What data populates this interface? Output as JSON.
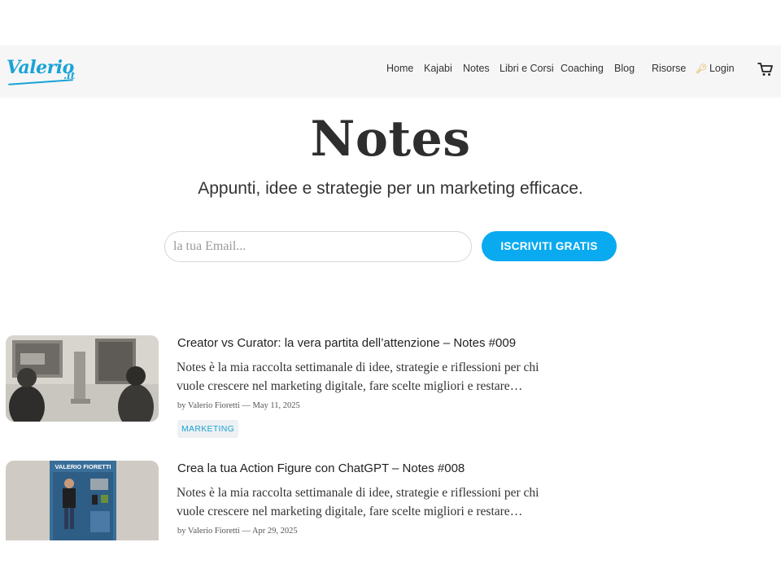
{
  "brand": {
    "logo_text": "Valerio",
    "logo_tld": ".it",
    "accent": "#1aa3d6"
  },
  "nav": {
    "items": [
      "Home",
      "Kajabi",
      "Notes",
      "Libri e Corsi",
      "Coaching",
      "Blog",
      "Risorse"
    ],
    "login": "Login",
    "login_icon": "key-icon",
    "cart_icon": "cart-icon"
  },
  "hero": {
    "title": "Notes",
    "subtitle": "Appunti, idee e strategie per un marketing efficace."
  },
  "subscribe": {
    "placeholder": "la tua Email...",
    "value": "",
    "button": "ISCRIVITI GRATIS",
    "button_color": "#0aaaf0"
  },
  "posts": [
    {
      "title": "Creator vs Curator: la vera partita dell’attenzione – Notes #009",
      "excerpt_line1": "Notes è la mia raccolta settimanale di idee, strategie e riflessioni per chi",
      "excerpt_line2": "vuole crescere nel marketing digitale, fare scelte migliori e restare…",
      "meta": "by Valerio Fioretti — May 11, 2025",
      "tag": "MARKETING"
    },
    {
      "title": "Crea la tua Action Figure con ChatGPT – Notes #008",
      "excerpt_line1": "Notes è la mia raccolta settimanale di idee, strategie e riflessioni per chi",
      "excerpt_line2": "vuole crescere nel marketing digitale, fare scelte migliori e restare…",
      "meta": "by Valerio Fioretti — Apr 29, 2025",
      "thumb_caption": "VALERIO FIORETTI"
    }
  ]
}
